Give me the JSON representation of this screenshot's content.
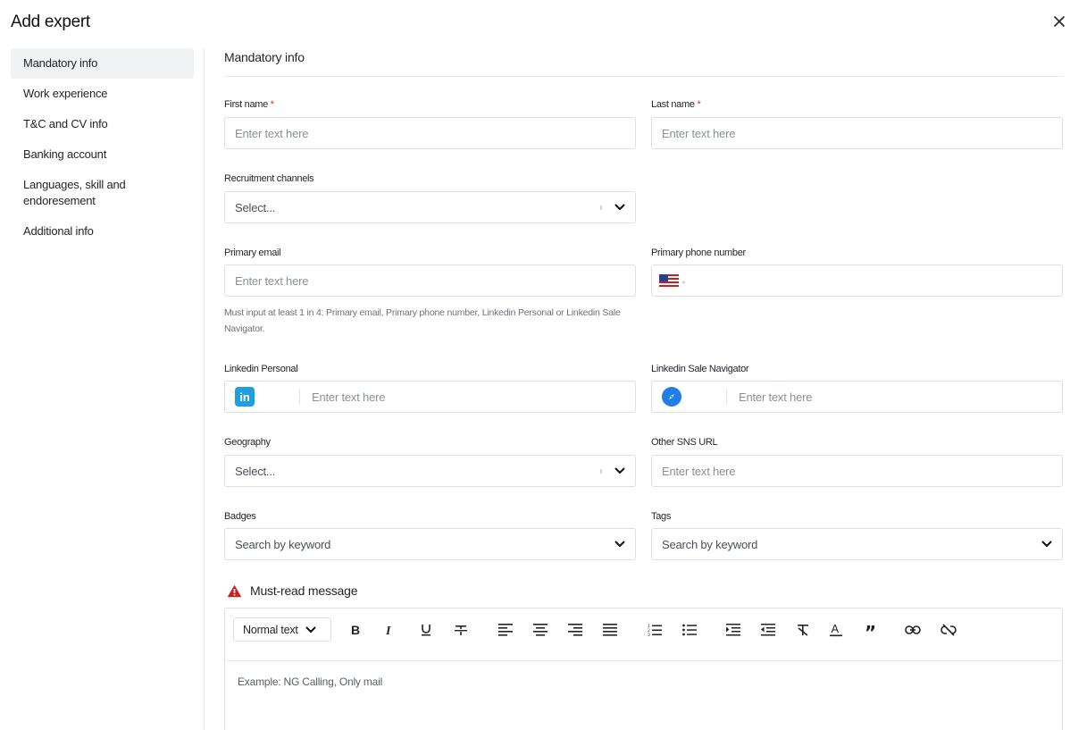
{
  "header": {
    "title": "Add expert",
    "close_icon": "close-icon"
  },
  "sidebar": {
    "items": [
      {
        "label": "Mandatory info",
        "active": true
      },
      {
        "label": "Work experience"
      },
      {
        "label": "T&C and CV info"
      },
      {
        "label": "Banking account"
      },
      {
        "label": "Languages, skill and endoresement"
      },
      {
        "label": "Additional info"
      }
    ]
  },
  "section": {
    "title": "Mandatory info"
  },
  "form": {
    "first_name": {
      "label": "First name",
      "required": "*",
      "placeholder": "Enter text here"
    },
    "last_name": {
      "label": "Last name",
      "required": "*",
      "placeholder": "Enter text here"
    },
    "recruitment_channels": {
      "label": "Recruitment channels",
      "value": "Select..."
    },
    "primary_email": {
      "label": "Primary email",
      "placeholder": "Enter text here"
    },
    "primary_phone": {
      "label": "Primary phone number",
      "flag": "us-flag-icon"
    },
    "hint": "Must input at least 1 in 4: Primary email, Primary phone number, Linkedin Personal or Linkedin Sale Navigator.",
    "linkedin_personal": {
      "label": "Linkedin Personal",
      "placeholder": "Enter text here",
      "icon_text": "in"
    },
    "linkedin_sales": {
      "label": "Linkedin Sale Navigator",
      "placeholder": "Enter text here"
    },
    "geography": {
      "label": "Geography",
      "value": "Select..."
    },
    "other_sns": {
      "label": "Other SNS URL",
      "placeholder": "Enter text here"
    },
    "badges": {
      "label": "Badges",
      "placeholder": "Search by keyword"
    },
    "tags": {
      "label": "Tags",
      "placeholder": "Search by keyword"
    }
  },
  "must_read": {
    "title": "Must-read message",
    "text_style": "Normal text",
    "body_placeholder": "Example: NG Calling, Only mail"
  },
  "colors": {
    "required": "#d4351c",
    "warning": "#c8201f",
    "linkedin": "#1f9ee0",
    "navigator": "#1f7fe6"
  }
}
